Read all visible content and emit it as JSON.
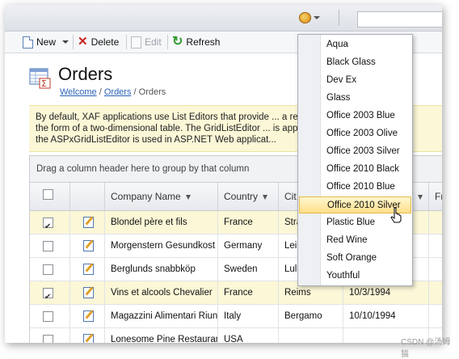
{
  "toolbar": {
    "new_label": "New",
    "delete_label": "Delete",
    "edit_label": "Edit",
    "refresh_label": "Refresh"
  },
  "header": {
    "title": "Orders",
    "breadcrumb": [
      "Welcome",
      "Orders",
      "Orders"
    ]
  },
  "info": {
    "text": "By default, XAF applications use List Editors that provide ... a repre\nthe form of a two-dimensional table. The GridListEditor ... is appli\nthe ASPxGridListEditor is used in ASP.NET Web applicat..."
  },
  "grid": {
    "group_panel_text": "Drag a column header here to group by that column",
    "columns": [
      "Company Name",
      "Country",
      "Cit",
      "",
      "Fr"
    ],
    "rows": [
      {
        "selected": true,
        "company": "Blondel père et fils",
        "country": "France",
        "city": "Stra",
        "date": ""
      },
      {
        "selected": false,
        "company": "Morgenstern Gesundkost",
        "country": "Germany",
        "city": "Leip",
        "date": ""
      },
      {
        "selected": false,
        "company": "Berglunds snabbköp",
        "country": "Sweden",
        "city": "Lule",
        "date": ""
      },
      {
        "selected": true,
        "company": "Vins et alcools Chevalier",
        "country": "France",
        "city": "Reims",
        "date": "10/3/1994"
      },
      {
        "selected": false,
        "company": "Magazzini Alimentari Riuniti",
        "country": "Italy",
        "city": "Bergamo",
        "date": "10/10/1994"
      },
      {
        "selected": false,
        "company": "Lonesome Pine Restaurant",
        "country": "USA",
        "city": "",
        "date": ""
      }
    ]
  },
  "theme_menu": {
    "items": [
      "Aqua",
      "Black Glass",
      "Dev Ex",
      "Glass",
      "Office 2003 Blue",
      "Office 2003 Olive",
      "Office 2003 Silver",
      "Office 2010 Black",
      "Office 2010 Blue",
      "Office 2010 Silver",
      "Plastic Blue",
      "Red Wine",
      "Soft Orange",
      "Youthful"
    ],
    "highlighted_index": 9
  },
  "watermark": "CSDN @汤姆 猫"
}
